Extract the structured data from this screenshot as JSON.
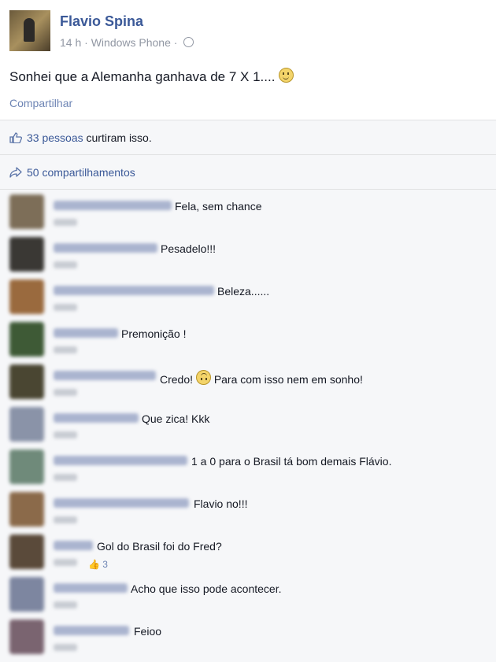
{
  "post": {
    "author": "Flavio Spina",
    "time": "14 h",
    "source": "Windows Phone",
    "text": "Sonhei que a Alemanha ganhava de 7 X 1....",
    "share_action": "Compartilhar"
  },
  "likes": {
    "count_text": "33 pessoas",
    "suffix": " curtiram isso."
  },
  "shares": {
    "text": "50 compartilhamentos"
  },
  "comments": [
    {
      "text": "Fela, sem chance"
    },
    {
      "text": "Pesadelo!!!"
    },
    {
      "text": "Beleza......"
    },
    {
      "text": "Premonição !"
    },
    {
      "text_before": "Credo!",
      "text_after": "Para com isso nem em sonho!"
    },
    {
      "text": "Que zica! Kkk"
    },
    {
      "text": "1 a 0 para o Brasil tá bom demais Flávio."
    },
    {
      "text": "Flavio no!!!"
    },
    {
      "text": "Gol do Brasil foi do Fred?",
      "likes": "3"
    },
    {
      "text": "Acho que isso pode acontecer."
    },
    {
      "text": "Feioo"
    }
  ],
  "colors": {
    "link": "#3b5998",
    "muted": "#9197a3",
    "bg_panel": "#f6f7f9"
  },
  "icons": [
    "globe-icon",
    "like-thumb-icon",
    "share-arrow-icon",
    "smiley-icon",
    "frown-icon"
  ]
}
